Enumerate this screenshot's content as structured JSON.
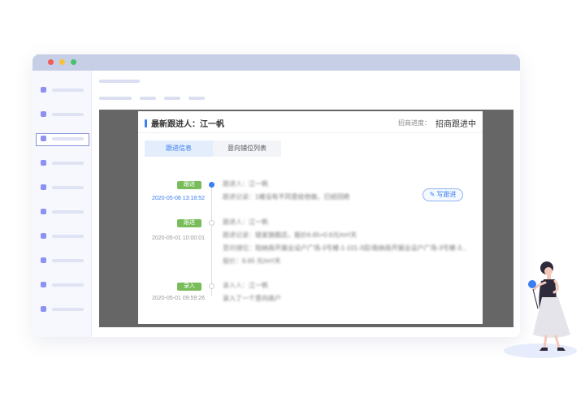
{
  "window": {
    "traffic_lights": [
      "close",
      "minimize",
      "maximize"
    ],
    "colors": {
      "red": "#f25b5b",
      "yellow": "#f7c33b",
      "green": "#46c26a",
      "accent": "#3b7ff0",
      "badge": "#79bd5b"
    }
  },
  "card": {
    "owner_line": "最新跟进人：江一帆",
    "progress_label": "招商进度：",
    "progress_value": "招商跟进中",
    "tabs": [
      "跟进信息",
      "意向铺位列表"
    ],
    "write_button": "写跟进",
    "timeline": [
      {
        "badge": "跟进",
        "time": "2020-05-08 13:18:52",
        "lines": [
          {
            "key": "跟进人：",
            "value": "江一帆"
          },
          {
            "key": "跟进记录：",
            "value": "1楼没有不同意给他做，已经回绝"
          }
        ]
      },
      {
        "badge": "跟进",
        "time": "2020-05-01 10:00:01",
        "lines": [
          {
            "key": "跟进人：",
            "value": "江一帆"
          },
          {
            "key": "跟进记录：",
            "value": "链家旗舰店，报价6.65+0.6元/m²/天"
          },
          {
            "key": "意向铺位：",
            "value": "珀纳商开展业设户广场-3号楼-1-101-3层/南纳商开展业设户广场-3号楼-3..."
          },
          {
            "key": "报价：",
            "value": "6.65 元/m²/天"
          }
        ]
      },
      {
        "badge": "录入",
        "time": "2020-05-01 09:59:26",
        "lines": [
          {
            "key": "录入人：",
            "value": "江一帆"
          },
          {
            "key": "",
            "value": "录入了一个意向商户"
          }
        ]
      }
    ]
  },
  "icons": {
    "write": "pencil-icon"
  }
}
